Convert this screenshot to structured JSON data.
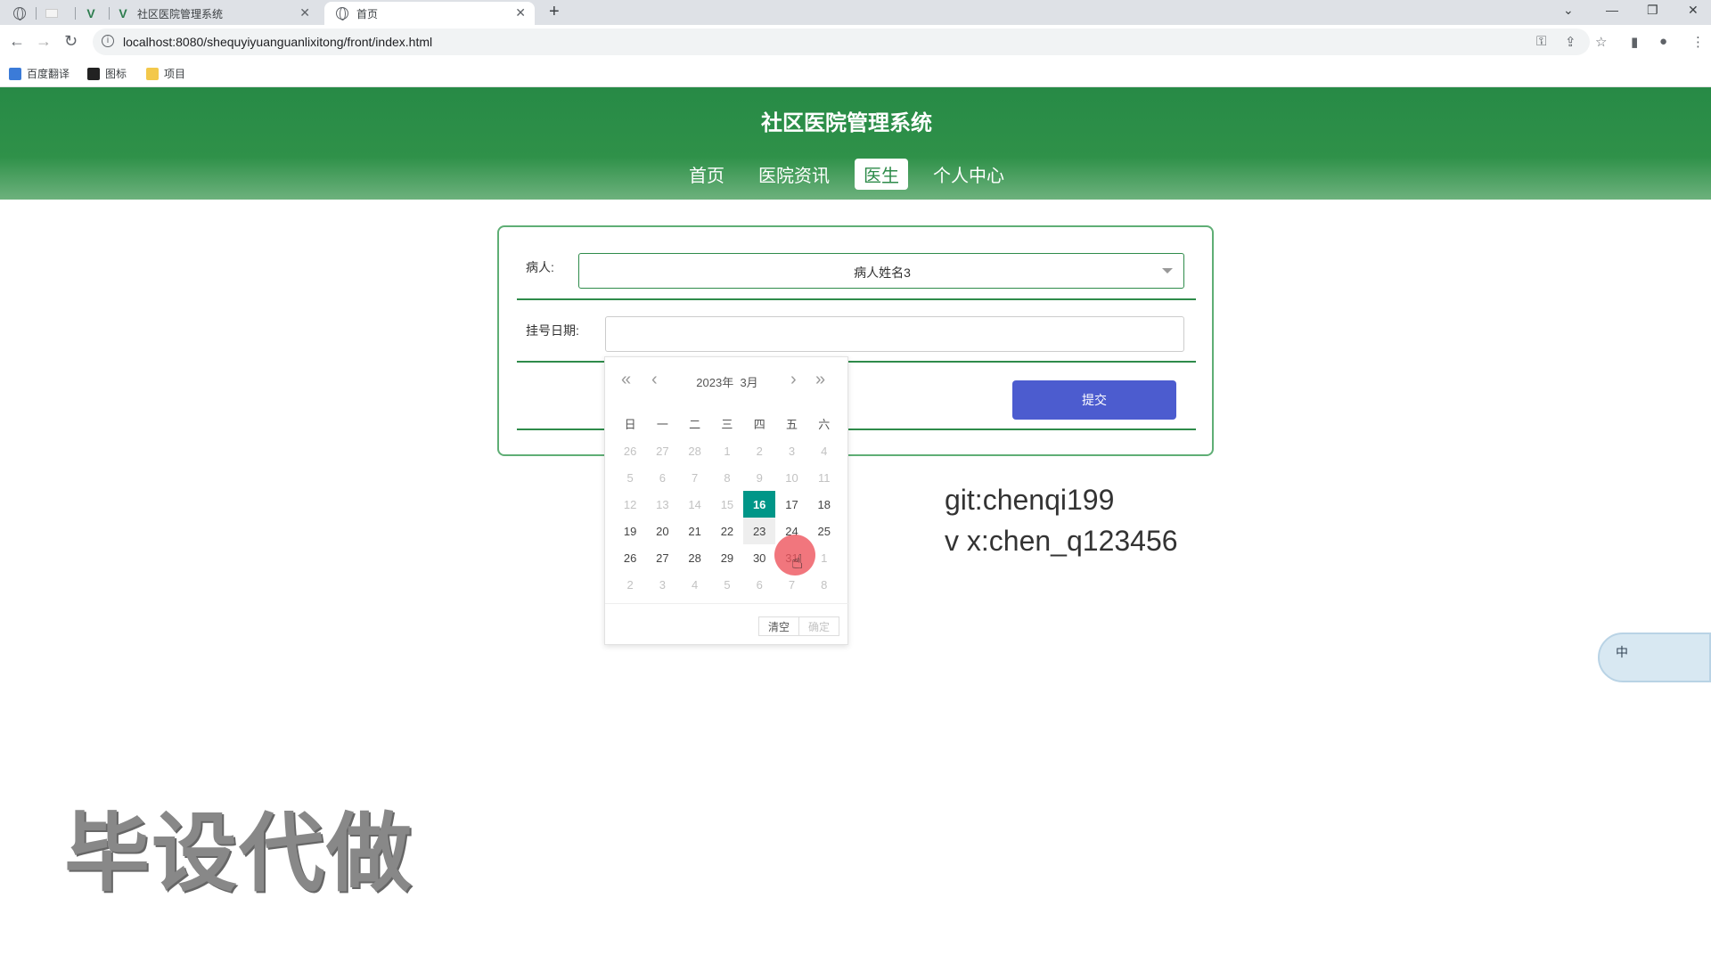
{
  "browser": {
    "tabs": [
      {
        "title": "",
        "icon": "globe-icon"
      },
      {
        "title": "",
        "icon": "blank-icon"
      },
      {
        "title": "",
        "icon": "vue-icon"
      },
      {
        "title": "社区医院管理系统",
        "icon": "vue-icon"
      },
      {
        "title": "首页",
        "icon": "globe-icon"
      }
    ],
    "new_tab": "+",
    "url": "localhost:8080/shequyiyuanguanlixitong/front/index.html",
    "bookmarks": [
      "百度翻译",
      "图标",
      "项目"
    ]
  },
  "site": {
    "title": "社区医院管理系统",
    "nav": [
      "首页",
      "医院资讯",
      "医生",
      "个人中心"
    ],
    "active_nav": "医生"
  },
  "form": {
    "patient_label": "病人:",
    "patient_value": "病人姓名3",
    "date_label": "挂号日期:",
    "date_value": "",
    "submit_label": "提交"
  },
  "datepicker": {
    "year_label": "2023年",
    "month_label": "3月",
    "weekdays": [
      "日",
      "一",
      "二",
      "三",
      "四",
      "五",
      "六"
    ],
    "weeks": [
      [
        "26",
        "27",
        "28",
        "1",
        "2",
        "3",
        "4"
      ],
      [
        "5",
        "6",
        "7",
        "8",
        "9",
        "10",
        "11"
      ],
      [
        "12",
        "13",
        "14",
        "15",
        "16",
        "17",
        "18"
      ],
      [
        "19",
        "20",
        "21",
        "22",
        "23",
        "24",
        "25"
      ],
      [
        "26",
        "27",
        "28",
        "29",
        "30",
        "31",
        "1"
      ],
      [
        "2",
        "3",
        "4",
        "5",
        "6",
        "7",
        "8"
      ]
    ],
    "selected_day": "16",
    "today_day": "23",
    "clear_label": "清空",
    "confirm_label": "确定"
  },
  "overlay": {
    "git_line": "git:chenqi199",
    "vx_line": "v x:chen_q123456",
    "watermark": "毕设代做",
    "ime_label": "中"
  },
  "colors": {
    "header_green": "#2f9149",
    "selected_day": "#009688",
    "submit_button": "#4c5ccf"
  }
}
